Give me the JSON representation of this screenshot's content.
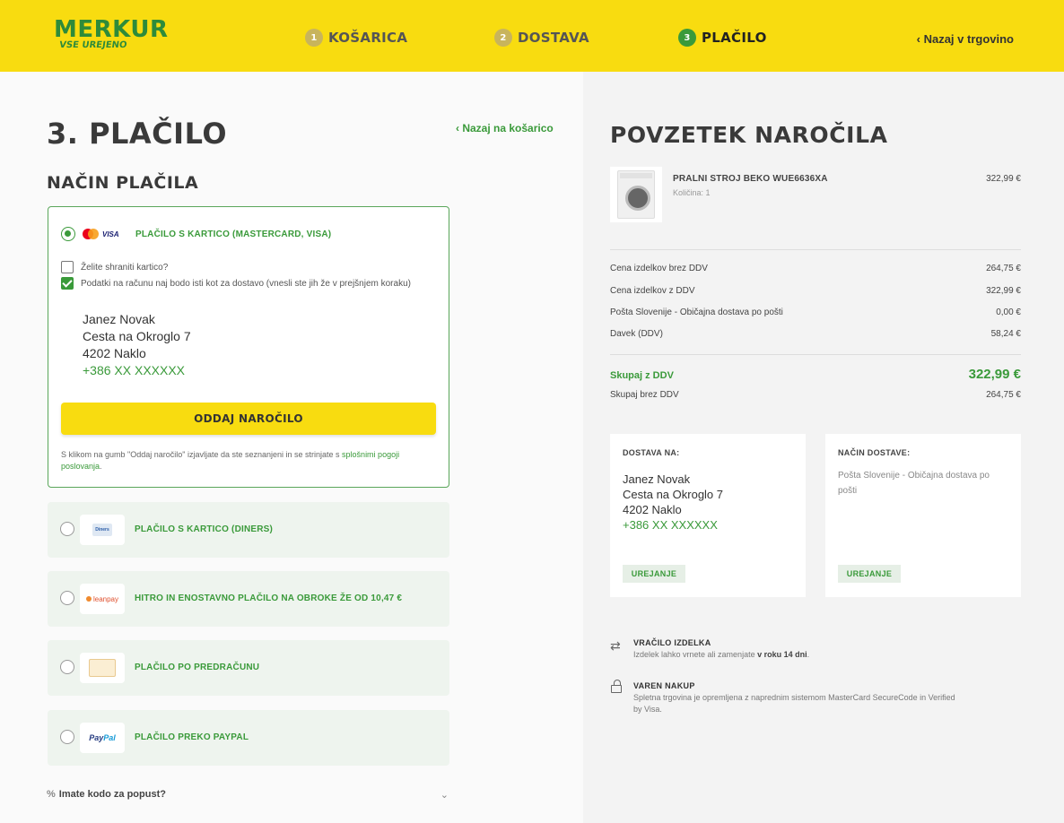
{
  "header": {
    "logo_main": "MERKUR",
    "logo_sub": "VSE UREJENO",
    "steps": [
      {
        "num": "1",
        "label": "KOŠARICA"
      },
      {
        "num": "2",
        "label": "DOSTAVA"
      },
      {
        "num": "3",
        "label": "PLAČILO"
      }
    ],
    "back_to_shop": "‹ Nazaj v trgovino"
  },
  "left": {
    "page_title": "3. PLAČILO",
    "back_to_cart": "‹ Nazaj na košarico",
    "section_title": "NAČIN PLAČILA",
    "card_payment": {
      "label": "PLAČILO S KARTICO (MASTERCARD, VISA)",
      "visa_text": "VISA",
      "save_card": "Želite shraniti kartico?",
      "same_as_delivery": "Podatki na računu naj bodo isti kot za dostavo (vnesli ste jih že v prejšnjem koraku)",
      "address": {
        "name": "Janez Novak",
        "street": "Cesta na Okroglo 7",
        "city": "4202 Naklo",
        "phone": "+386 XX XXXXXX"
      },
      "order_button": "ODDAJ NAROČILO",
      "terms_text": "S klikom na gumb \"Oddaj naročilo\" izjavljate da ste seznanjeni in se strinjate s ",
      "terms_link": "splošnimi pogoji poslovanja",
      "terms_end": "."
    },
    "options": [
      {
        "label": "PLAČILO S KARTICO (DINERS)",
        "logo_text": "Diners"
      },
      {
        "label": "HITRO IN ENOSTAVNO PLAČILO NA OBROKE ŽE OD 10,47 €",
        "logo_text": "leanpay"
      },
      {
        "label": "PLAČILO PO PREDRAČUNU",
        "logo_text": ""
      },
      {
        "label": "PLAČILO PREKO PAYPAL",
        "logo_text": "Pay",
        "logo_text2": "Pal"
      }
    ],
    "discount": "Imate kodo za popust?"
  },
  "summary": {
    "title": "POVZETEK NAROČILA",
    "product": {
      "name": "PRALNI STROJ BEKO WUE6636XA",
      "qty": "Količina: 1",
      "price": "322,99 €"
    },
    "rows": [
      {
        "label": "Cena izdelkov brez DDV",
        "value": "264,75 €"
      },
      {
        "label": "Cena izdelkov z DDV",
        "value": "322,99 €"
      },
      {
        "label": "Pošta Slovenije - Običajna dostava po pošti",
        "value": "0,00 €"
      },
      {
        "label": "Davek (DDV)",
        "value": "58,24 €"
      }
    ],
    "total_with_vat": {
      "label": "Skupaj z DDV",
      "value": "322,99 €"
    },
    "total_without_vat": {
      "label": "Skupaj brez DDV",
      "value": "264,75 €"
    },
    "delivery_to": {
      "title": "DOSTAVA NA:",
      "name": "Janez Novak",
      "street": "Cesta na Okroglo 7",
      "city": "4202 Naklo",
      "phone": "+386 XX XXXXXX",
      "edit": "UREJANJE"
    },
    "delivery_method": {
      "title": "NAČIN DOSTAVE:",
      "text": "Pošta Slovenije - Običajna dostava po pošti",
      "edit": "UREJANJE"
    },
    "return": {
      "title": "VRAČILO IZDELKA",
      "text": "Izdelek lahko vrnete ali zamenjate ",
      "bold": "v roku 14 dni",
      "end": "."
    },
    "secure": {
      "title": "VAREN NAKUP",
      "text": "Spletna trgovina je opremljena z naprednim sistemom MasterCard SecureCode in Verified by Visa."
    }
  },
  "colors": {
    "accent_yellow": "#f8dc10",
    "accent_green": "#3a9a3a"
  }
}
